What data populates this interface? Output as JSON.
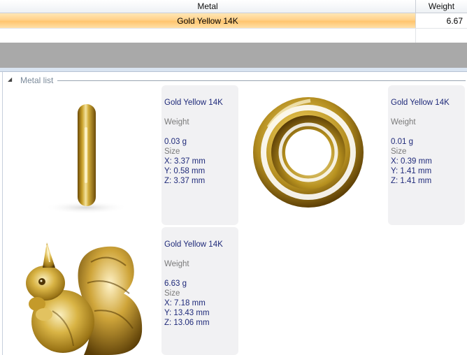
{
  "grid": {
    "columns": {
      "metal": "Metal",
      "weight": "Weight"
    },
    "rows": [
      {
        "metal": "Gold Yellow 14K",
        "weight": "6.67"
      }
    ]
  },
  "metal_list": {
    "title": "Metal list",
    "toggle_glyph": "◢",
    "size_label": "Size",
    "weight_label": "Weight",
    "items": [
      {
        "name": "Gold Yellow 14K",
        "weight": "0.03 g",
        "x": "X: 3.37 mm",
        "y": "Y: 0.58 mm",
        "z": "Z: 3.37 mm",
        "thumbnail": "gold-ring-side-view"
      },
      {
        "name": "Gold Yellow 14K",
        "weight": "0.01 g",
        "x": "X: 0.39 mm",
        "y": "Y: 1.41 mm",
        "z": "Z: 1.41 mm",
        "thumbnail": "gold-ring-front-view"
      },
      {
        "name": "Gold Yellow 14K",
        "weight": "6.63 g",
        "x": "X: 7.18 mm",
        "y": "Y: 13.43 mm",
        "z": "Z: 13.06 mm",
        "thumbnail": "gold-squirrel-figure"
      }
    ]
  },
  "colors": {
    "selected_row": "#ffd18a",
    "gold_light": "#f4e3a0",
    "gold_mid": "#c9a028",
    "gold_dark": "#6b4a08",
    "info_text": "#1f2a7a",
    "label_text": "#7a7a7a"
  }
}
